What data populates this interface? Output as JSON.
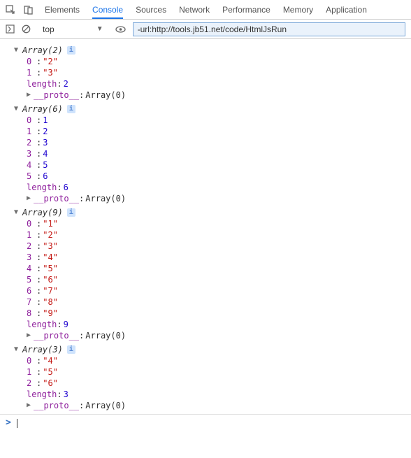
{
  "tabs": [
    "Elements",
    "Console",
    "Sources",
    "Network",
    "Performance",
    "Memory",
    "Application"
  ],
  "active_tab": "Console",
  "context": "top",
  "filter_value": "-url:http://tools.jb51.net/code/HtmlJsRun",
  "proto_label": "__proto__",
  "proto_value": "Array(0)",
  "length_label": "length",
  "prompt_symbol": ">",
  "arrays": [
    {
      "title": "Array",
      "count": 2,
      "items": [
        {
          "idx": "0",
          "type": "str",
          "val": "\"2\""
        },
        {
          "idx": "1",
          "type": "str",
          "val": "\"3\""
        }
      ],
      "length": 2
    },
    {
      "title": "Array",
      "count": 6,
      "items": [
        {
          "idx": "0",
          "type": "num",
          "val": "1"
        },
        {
          "idx": "1",
          "type": "num",
          "val": "2"
        },
        {
          "idx": "2",
          "type": "num",
          "val": "3"
        },
        {
          "idx": "3",
          "type": "num",
          "val": "4"
        },
        {
          "idx": "4",
          "type": "num",
          "val": "5"
        },
        {
          "idx": "5",
          "type": "num",
          "val": "6"
        }
      ],
      "length": 6
    },
    {
      "title": "Array",
      "count": 9,
      "items": [
        {
          "idx": "0",
          "type": "str",
          "val": "\"1\""
        },
        {
          "idx": "1",
          "type": "str",
          "val": "\"2\""
        },
        {
          "idx": "2",
          "type": "str",
          "val": "\"3\""
        },
        {
          "idx": "3",
          "type": "str",
          "val": "\"4\""
        },
        {
          "idx": "4",
          "type": "str",
          "val": "\"5\""
        },
        {
          "idx": "5",
          "type": "str",
          "val": "\"6\""
        },
        {
          "idx": "6",
          "type": "str",
          "val": "\"7\""
        },
        {
          "idx": "7",
          "type": "str",
          "val": "\"8\""
        },
        {
          "idx": "8",
          "type": "str",
          "val": "\"9\""
        }
      ],
      "length": 9
    },
    {
      "title": "Array",
      "count": 3,
      "items": [
        {
          "idx": "0",
          "type": "str",
          "val": "\"4\""
        },
        {
          "idx": "1",
          "type": "str",
          "val": "\"5\""
        },
        {
          "idx": "2",
          "type": "str",
          "val": "\"6\""
        }
      ],
      "length": 3
    }
  ]
}
